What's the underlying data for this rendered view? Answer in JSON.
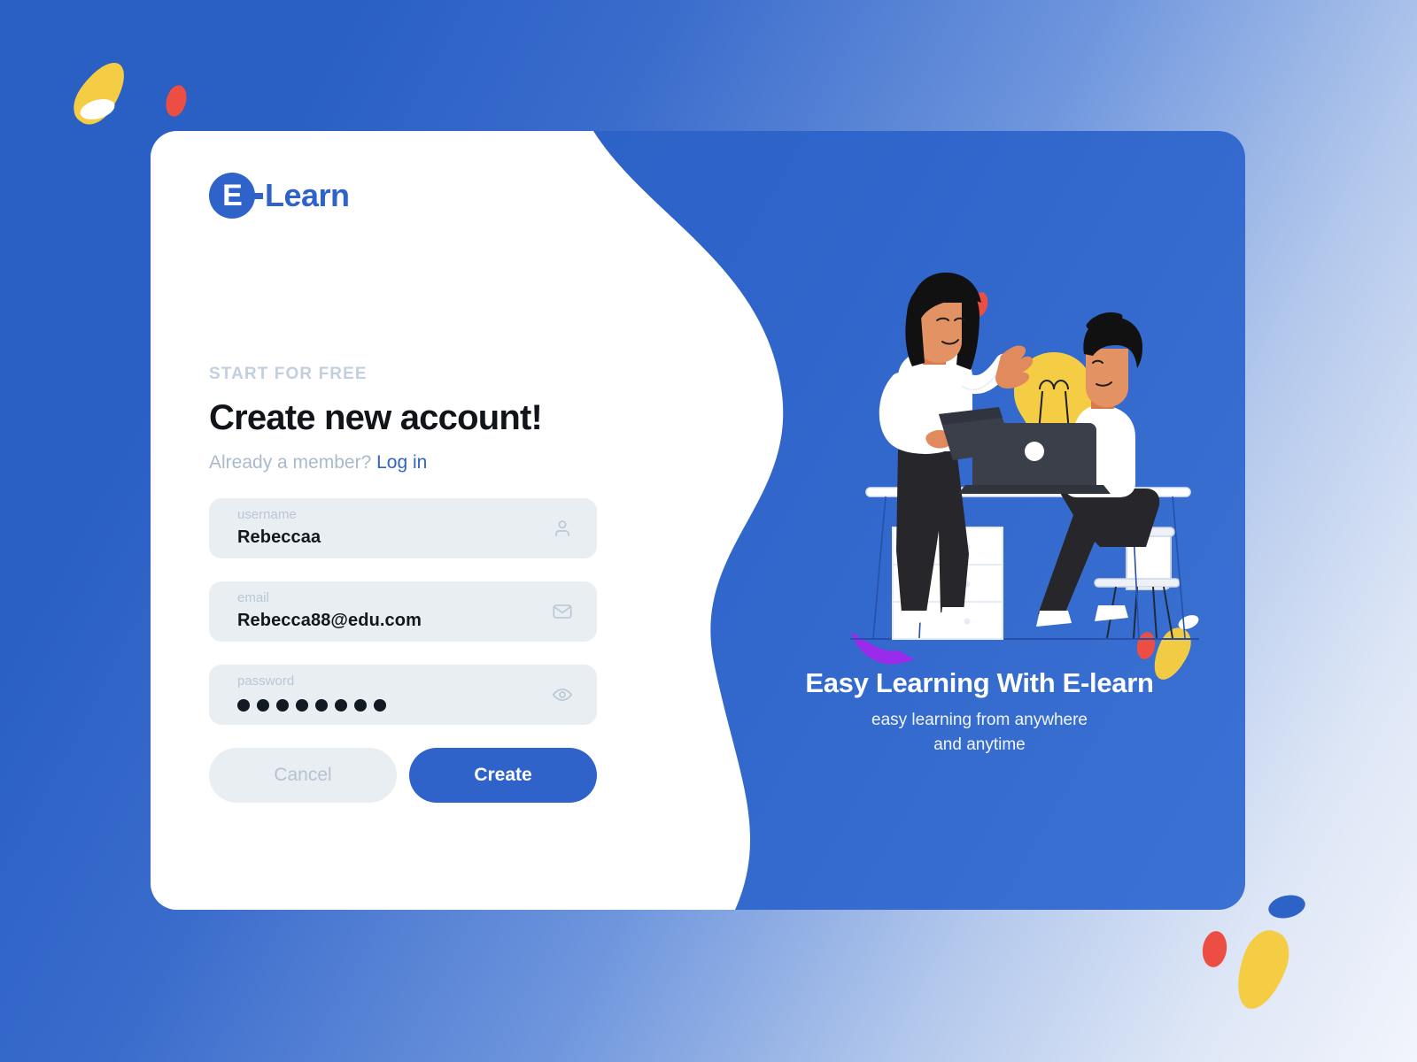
{
  "brand": {
    "logo_letter": "E",
    "logo_text": "Learn",
    "logo_icon": "e-learn-circle-logo",
    "accent_blue": "#2f63c9",
    "field_bg": "#e9eef2",
    "muted_text": "#b9c7d6"
  },
  "form": {
    "eyebrow": "START FOR FREE",
    "title": "Create new account!",
    "member_prompt": "Already a member?",
    "login_link": "Log in",
    "fields": [
      {
        "label": "username",
        "value": "Rebeccaa",
        "placeholder": "username",
        "icon": "user-icon",
        "type": "text"
      },
      {
        "label": "email",
        "value": "Rebecca88@edu.com",
        "placeholder": "email",
        "icon": "envelope-icon",
        "type": "email"
      },
      {
        "label": "password",
        "value": "••••••••",
        "masked_char_count": 8,
        "placeholder": "password",
        "icon": "eye-icon",
        "type": "password"
      }
    ],
    "cancel_label": "Cancel",
    "create_label": "Create"
  },
  "promo": {
    "title": "Easy Learning With E-learn",
    "subtitle": "easy learning from anywhere\nand anytime",
    "subtitle_line1": "easy learning from anywhere",
    "subtitle_line2": "and anytime",
    "illustration": "two-people-studying-with-laptops-and-lightbulb"
  },
  "decorations": {
    "top_left": [
      "yellow-cone",
      "red-ellipse",
      "white-ellipse"
    ],
    "bottom_right": [
      "blue-ellipse",
      "red-ellipse",
      "yellow-cone"
    ],
    "panel": [
      "yellow-cone",
      "red-ellipse",
      "white-ellipse",
      "purple-arc"
    ]
  }
}
